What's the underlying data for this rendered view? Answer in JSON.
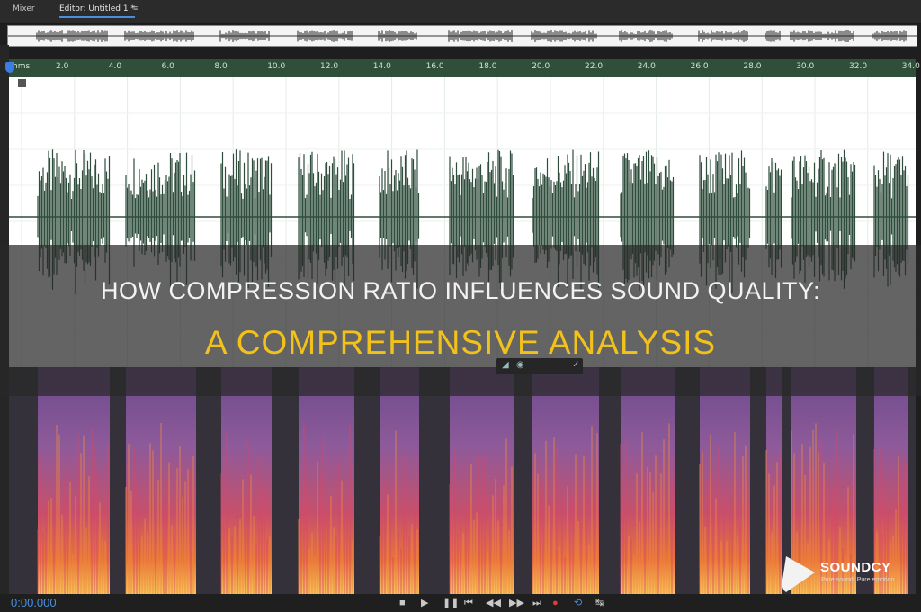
{
  "tabs": [
    {
      "label": "Mixer"
    },
    {
      "label": "Editor: Untitled 1 *"
    }
  ],
  "tab_menu_icon": "hamburger-menu-icon",
  "ruler": {
    "unit": "hms",
    "ticks": [
      "2.0",
      "4.0",
      "6.0",
      "8.0",
      "10.0",
      "12.0",
      "14.0",
      "16.0",
      "18.0",
      "20.0",
      "22.0",
      "24.0",
      "26.0",
      "28.0",
      "30.0",
      "32.0",
      "34.0"
    ]
  },
  "title": {
    "line1": "HOW COMPRESSION RATIO INFLUENCES SOUND QUALITY:",
    "line2": "A COMPREHENSIVE ANALYSIS"
  },
  "transport": {
    "timecode": "0:00.000",
    "buttons": [
      {
        "name": "stop",
        "icon": "stop-icon",
        "glyph": "■"
      },
      {
        "name": "play",
        "icon": "play-icon",
        "glyph": "▶"
      },
      {
        "name": "pause",
        "icon": "pause-icon",
        "glyph": "❚❚"
      },
      {
        "name": "go-to-start",
        "icon": "skip-back-icon",
        "glyph": "⏮"
      },
      {
        "name": "rewind",
        "icon": "rewind-icon",
        "glyph": "◀◀"
      },
      {
        "name": "fast-forward",
        "icon": "fast-forward-icon",
        "glyph": "▶▶"
      },
      {
        "name": "go-to-end",
        "icon": "skip-forward-icon",
        "glyph": "⏭"
      },
      {
        "name": "record",
        "icon": "record-icon",
        "glyph": "●"
      },
      {
        "name": "loop",
        "icon": "loop-icon",
        "glyph": "⟲"
      },
      {
        "name": "skip-selection",
        "icon": "skip-selection-icon",
        "glyph": "↹"
      }
    ]
  },
  "logo": {
    "name": "SOUNDCY",
    "tagline": "Pure sound, Pure emotion"
  },
  "colors": {
    "accent": "#4a8fdc",
    "waveform": "#2e4d3c",
    "ruler": "#2f4f3b",
    "title_highlight": "#f2c21b",
    "record": "#e03a3a"
  }
}
